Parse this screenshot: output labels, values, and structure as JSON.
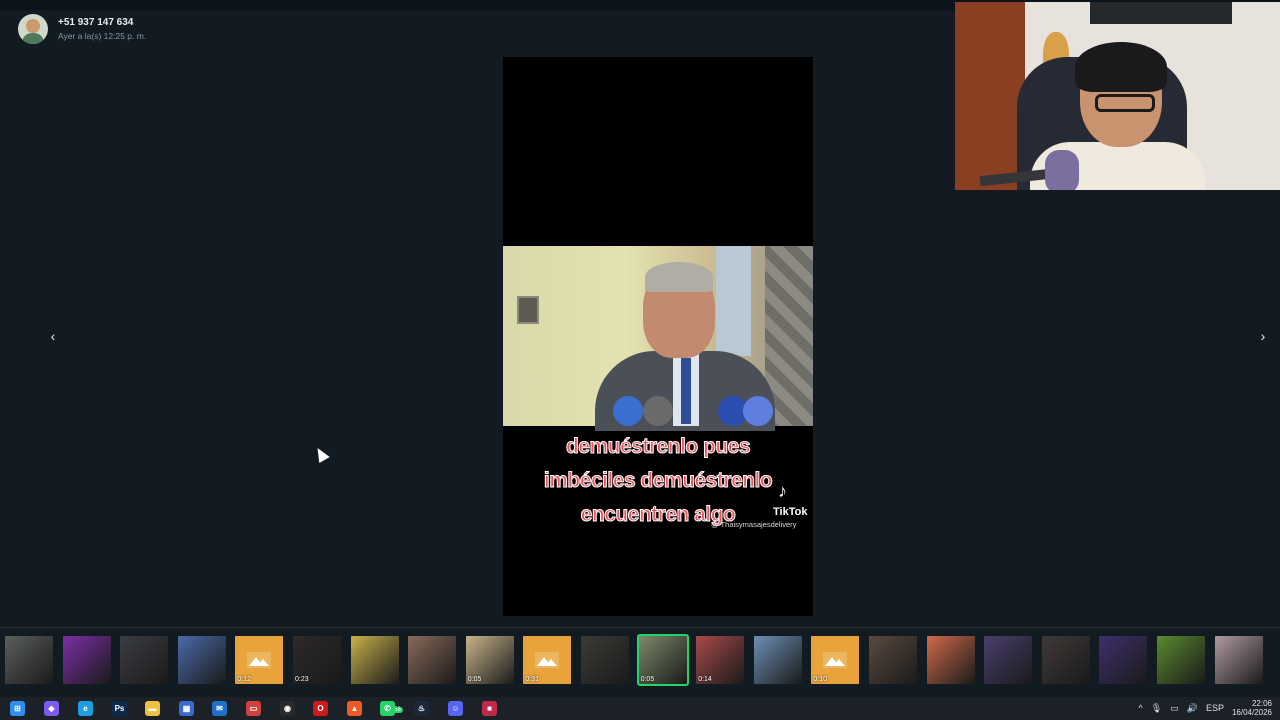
{
  "sender": {
    "name": "+51 937 147 634",
    "time": "Ayer a la(s) 12:25 p. m."
  },
  "media": {
    "caption_lines": [
      "demuéstrenlo pues",
      "imbéciles demuéstrenlo",
      "encuentren algo"
    ],
    "tiktok_logo": "♪",
    "tiktok_brand": "TikTok",
    "tiktok_user": "@ Thaisymasajesdelivery"
  },
  "nav": {
    "prev_icon": "chevron-left-icon",
    "next_icon": "chevron-right-icon",
    "prev_glyph": "‹",
    "next_glyph": "›"
  },
  "thumbnails": [
    {
      "kind": "image",
      "color": "#5a5f5c",
      "duration": ""
    },
    {
      "kind": "image",
      "color": "#7b2fa6",
      "duration": ""
    },
    {
      "kind": "image",
      "color": "#3a3d42",
      "duration": ""
    },
    {
      "kind": "image",
      "color": "#4a6aa8",
      "duration": ""
    },
    {
      "kind": "audio",
      "color": "#e8a43a",
      "duration": "0:12"
    },
    {
      "kind": "video",
      "color": "#2d2a28",
      "duration": "0:23"
    },
    {
      "kind": "image",
      "color": "#c9b24a",
      "duration": ""
    },
    {
      "kind": "image",
      "color": "#8a6a5a",
      "duration": ""
    },
    {
      "kind": "video",
      "color": "#c9b48a",
      "duration": "0:05"
    },
    {
      "kind": "audio",
      "color": "#e8a43a",
      "duration": "0:31"
    },
    {
      "kind": "image",
      "color": "#3b3a36",
      "duration": ""
    },
    {
      "kind": "video",
      "color": "#7d8a6a",
      "duration": "0:05",
      "active": true
    },
    {
      "kind": "video",
      "color": "#a84a4a",
      "duration": "0:14"
    },
    {
      "kind": "image",
      "color": "#6d8fb4",
      "duration": ""
    },
    {
      "kind": "audio",
      "color": "#e8a43a",
      "duration": "0:10"
    },
    {
      "kind": "image",
      "color": "#5a4a3f",
      "duration": ""
    },
    {
      "kind": "image",
      "color": "#d06a4a",
      "duration": ""
    },
    {
      "kind": "image",
      "color": "#4a3f6d",
      "duration": ""
    },
    {
      "kind": "image",
      "color": "#3f3a38",
      "duration": ""
    },
    {
      "kind": "image",
      "color": "#3d2f6a",
      "duration": ""
    },
    {
      "kind": "image",
      "color": "#5a8a2f",
      "duration": ""
    },
    {
      "kind": "image",
      "color": "#b09aa0",
      "duration": ""
    }
  ],
  "taskbar": {
    "icons": [
      {
        "name": "windows-start-icon",
        "color": "#2e8ff0",
        "glyph": "⊞"
      },
      {
        "name": "copilot-icon",
        "color": "#7c5cf0",
        "glyph": "◆"
      },
      {
        "name": "edge-icon",
        "color": "#1f9de0",
        "glyph": "e"
      },
      {
        "name": "photoshop-icon",
        "color": "#0d2a4d",
        "glyph": "Ps"
      },
      {
        "name": "file-explorer-icon",
        "color": "#f0c040",
        "glyph": "▬"
      },
      {
        "name": "store-icon",
        "color": "#3a6ad0",
        "glyph": "▦"
      },
      {
        "name": "outlook-icon",
        "color": "#1f70c8",
        "glyph": "✉"
      },
      {
        "name": "app-icon",
        "color": "#d04040",
        "glyph": "▭"
      },
      {
        "name": "obs-icon",
        "color": "#2a2a2a",
        "glyph": "◉"
      },
      {
        "name": "opera-icon",
        "color": "#d01a1a",
        "glyph": "O"
      },
      {
        "name": "brave-icon",
        "color": "#f05a28",
        "glyph": "▲"
      },
      {
        "name": "whatsapp-icon",
        "color": "#25d366",
        "glyph": "✆"
      },
      {
        "name": "steam-icon",
        "color": "#1b2838",
        "glyph": "♨"
      },
      {
        "name": "discord-icon",
        "color": "#5865f2",
        "glyph": "☺"
      },
      {
        "name": "app2-icon",
        "color": "#c02a4a",
        "glyph": "■"
      }
    ],
    "whatsapp_badge": "58",
    "tray": {
      "chevron": "^",
      "lang": "ESP",
      "time": "22:06",
      "date": "16/04/2026"
    }
  }
}
